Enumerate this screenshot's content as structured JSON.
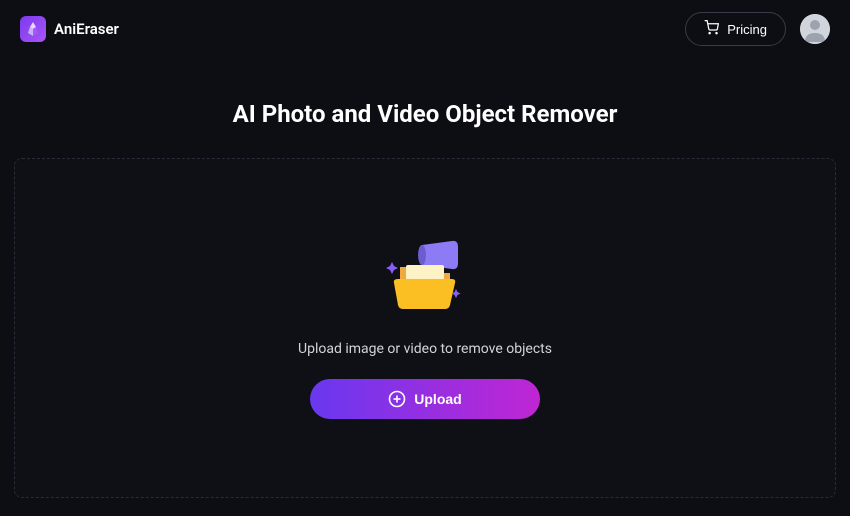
{
  "header": {
    "brand_name": "AniEraser",
    "pricing_label": "Pricing"
  },
  "main": {
    "title": "AI Photo and Video Object Remover",
    "upload_hint": "Upload image or video to remove objects",
    "upload_button_label": "Upload"
  },
  "colors": {
    "accent_gradient_start": "#6938ef",
    "accent_gradient_end": "#c026d3",
    "brand_purple": "#7c3aed"
  }
}
